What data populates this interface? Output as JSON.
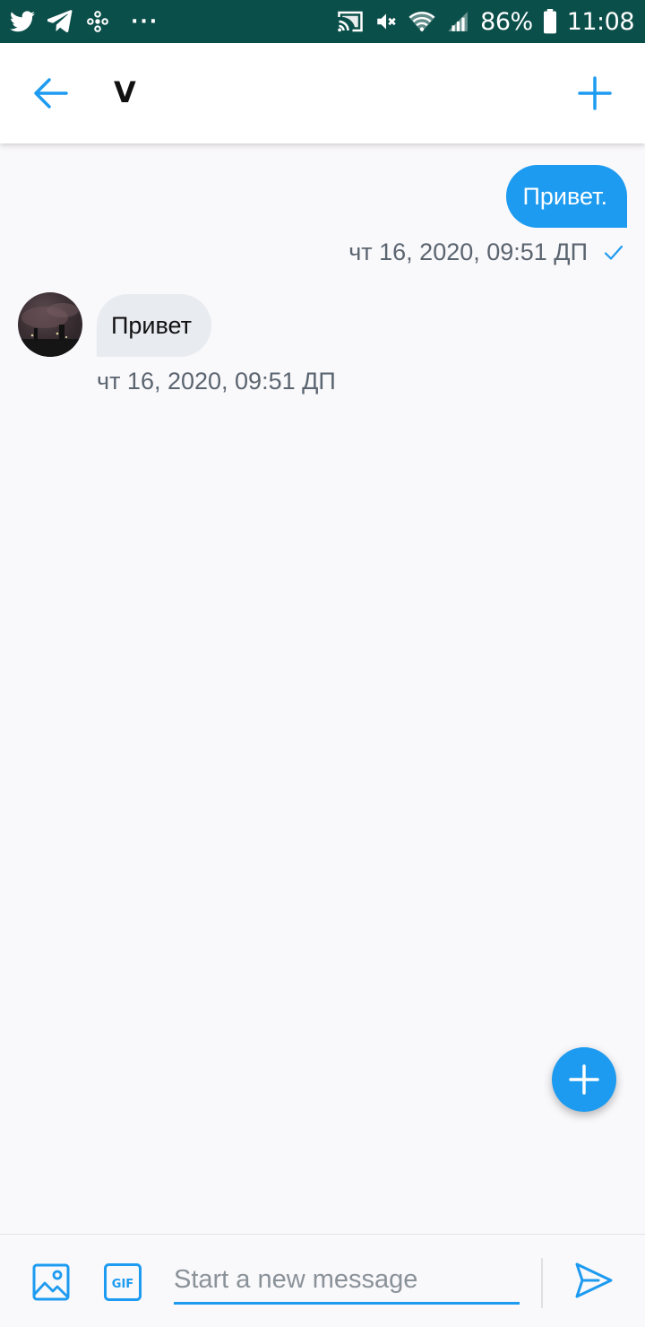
{
  "status_bar": {
    "battery_percent": "86%",
    "time": "11:08",
    "more_dots": "···",
    "left_icons": [
      "twitter-icon",
      "telegram-icon",
      "fan-icon"
    ],
    "right_icons": [
      "cast-icon",
      "mute-icon",
      "wifi-icon",
      "signal-icon",
      "battery-icon"
    ]
  },
  "header": {
    "title": "V"
  },
  "messages": [
    {
      "direction": "outgoing",
      "text": "Привет.",
      "timestamp": "чт 16, 2020, 09:51 ДП",
      "read": true
    },
    {
      "direction": "incoming",
      "text": "Привет",
      "timestamp": "чт 16, 2020, 09:51 ДП"
    }
  ],
  "compose": {
    "placeholder": "Start a new message",
    "value": "",
    "gif_label": "GIF"
  },
  "colors": {
    "accent": "#1d9bf0",
    "status_bar": "#0b4f4a",
    "incoming_bubble": "#e8ebf0",
    "background": "#f9f8fb"
  }
}
